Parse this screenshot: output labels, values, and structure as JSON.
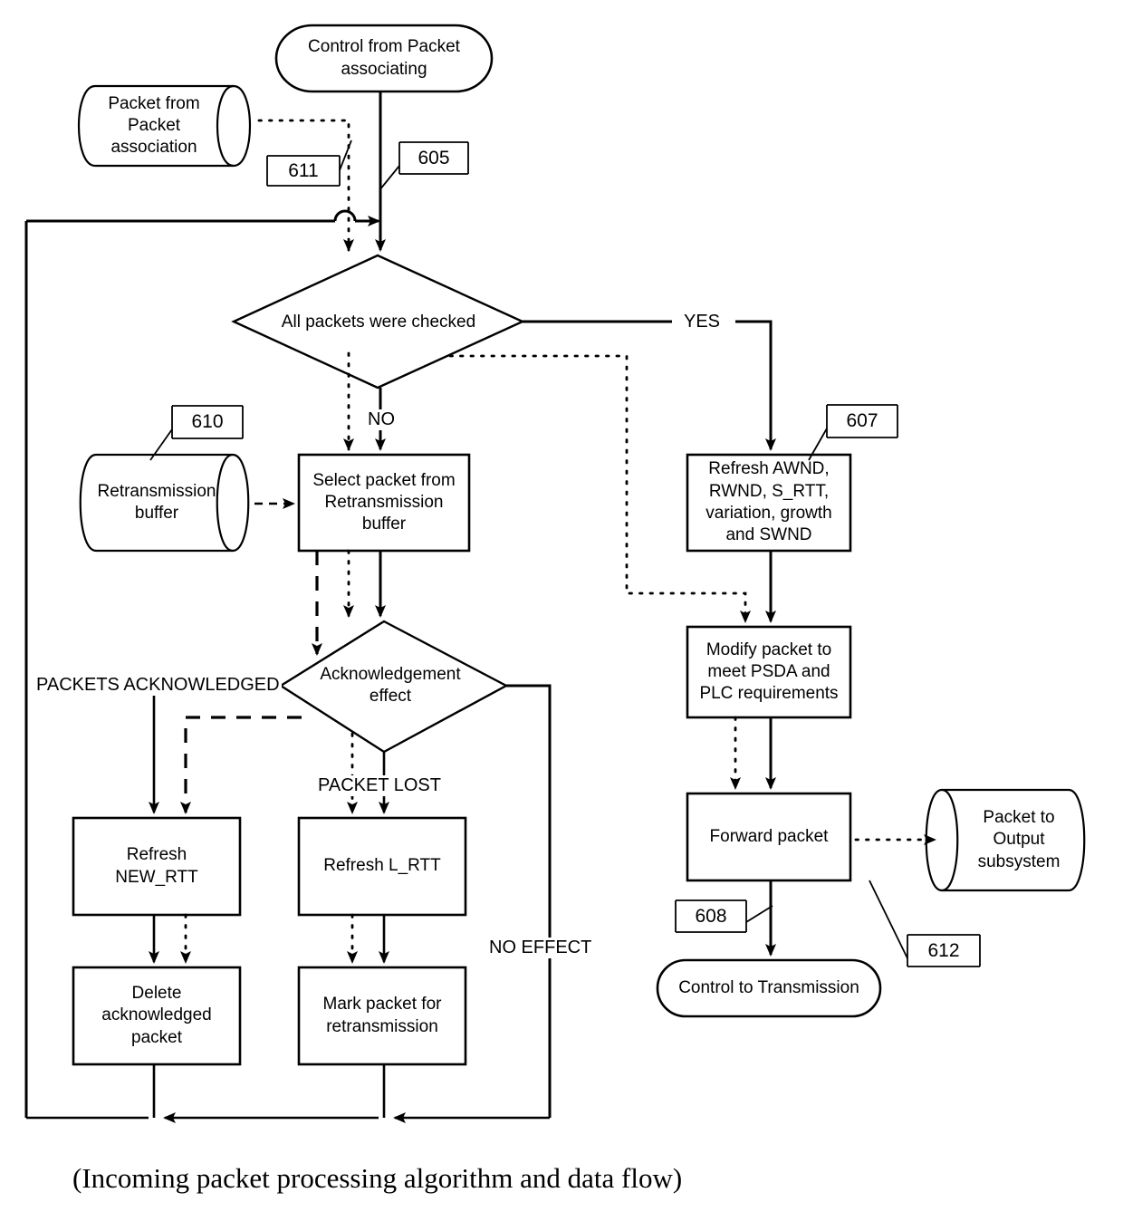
{
  "figure": {
    "caption": "(Incoming packet processing algorithm and data flow)"
  },
  "nodes": {
    "control_from_packet_associating": {
      "label": "Control from Packet\nassociating",
      "shape": "terminator"
    },
    "packet_from_packet_association": {
      "label": "Packet from\nPacket\nassociation",
      "shape": "cylinder"
    },
    "all_packets_were_checked": {
      "label": "All packets were checked",
      "shape": "decision"
    },
    "retransmission_buffer": {
      "label": "Retransmission\nbuffer",
      "shape": "cylinder"
    },
    "select_packet": {
      "label": "Select packet from\nRetransmission\nbuffer",
      "shape": "process"
    },
    "refresh_awnd": {
      "label": "Refresh AWND,\nRWND, S_RTT,\nvariation, growth\nand SWND",
      "shape": "process"
    },
    "acknowledgement_effect": {
      "label": "Acknowledgement\neffect",
      "shape": "decision"
    },
    "modify_packet": {
      "label": "Modify packet to\nmeet PSDA and\nPLC requirements",
      "shape": "process"
    },
    "refresh_new_rtt": {
      "label": "Refresh\nNEW_RTT",
      "shape": "process"
    },
    "refresh_l_rtt": {
      "label": "Refresh L_RTT",
      "shape": "process"
    },
    "forward_packet": {
      "label": "Forward packet",
      "shape": "process"
    },
    "packet_to_output_subsystem": {
      "label": "Packet to\nOutput\nsubsystem",
      "shape": "cylinder"
    },
    "delete_acknowledged_packet": {
      "label": "Delete\nacknowledged\npacket",
      "shape": "process"
    },
    "mark_packet_for_retransmission": {
      "label": "Mark packet for\nretransmission",
      "shape": "process"
    },
    "control_to_transmission": {
      "label": "Control to Transmission",
      "shape": "terminator"
    }
  },
  "reference_numerals": {
    "ref_611": "611",
    "ref_605": "605",
    "ref_610": "610",
    "ref_607": "607",
    "ref_608": "608",
    "ref_612": "612"
  },
  "edge_labels": {
    "yes": "YES",
    "no": "NO",
    "packets_acknowledged": "PACKETS ACKNOWLEDGED",
    "packet_lost": "PACKET LOST",
    "no_effect": "NO EFFECT"
  },
  "colors": {
    "stroke": "#000000",
    "background": "#ffffff"
  }
}
